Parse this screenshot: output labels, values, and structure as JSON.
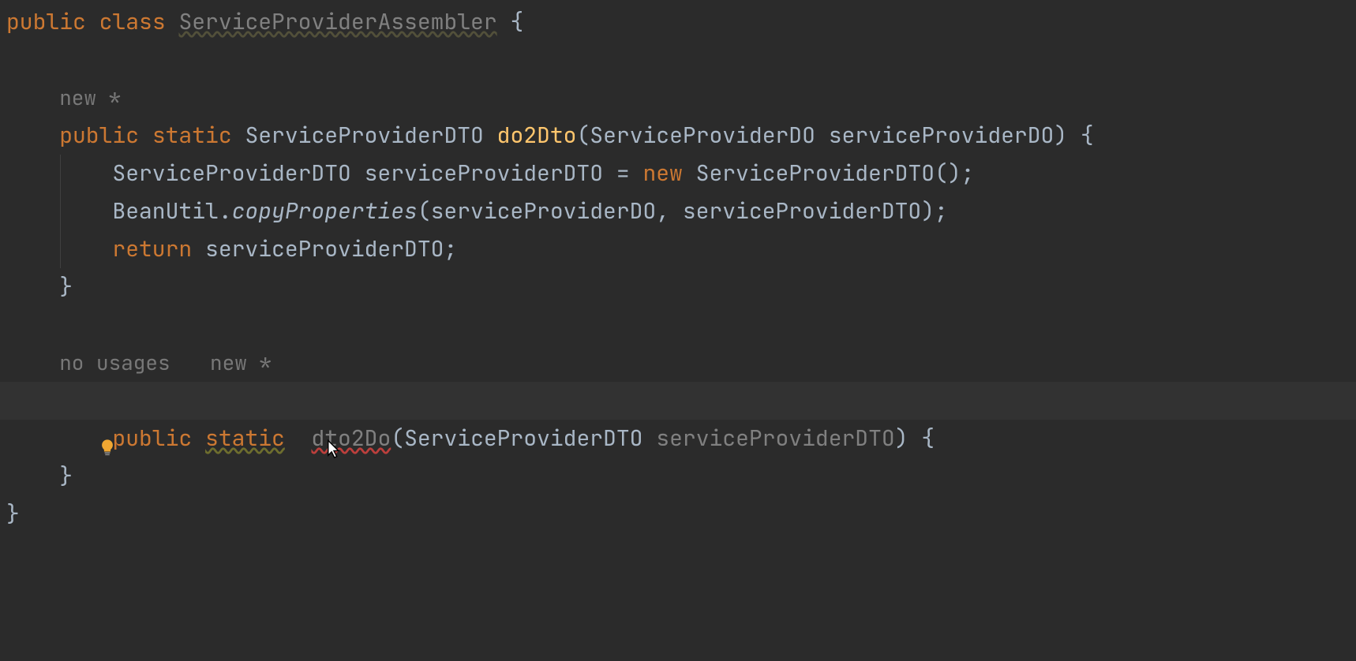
{
  "code": {
    "line1": {
      "kw_public": "public",
      "kw_class": "class",
      "classname": "ServiceProviderAssembler",
      "brace": " {"
    },
    "hint1": "new *",
    "line_method1_sig": {
      "kw_public": "public",
      "kw_static": "static",
      "ret_type": "ServiceProviderDTO",
      "method": "do2Dto",
      "paren_open": "(",
      "param_type": "ServiceProviderDO",
      "param_name": "serviceProviderDO",
      "paren_close_brace": ") {"
    },
    "line_body1": {
      "type": "ServiceProviderDTO",
      "var": "serviceProviderDTO",
      "eq": " = ",
      "kw_new": "new",
      "ctor": "ServiceProviderDTO",
      "tail": "();"
    },
    "line_body2": {
      "cls": "BeanUtil",
      "dot": ".",
      "method": "copyProperties",
      "args": "(serviceProviderDO, serviceProviderDTO);"
    },
    "line_body3": {
      "kw_return": "return",
      "var": "serviceProviderDTO",
      "semi": ";"
    },
    "close1": "}",
    "hint2a": "no usages",
    "hint2b": "new *",
    "line_method2_sig": {
      "kw_public": "public",
      "kw_static": "static",
      "method": "dto2Do",
      "paren_open": "(",
      "param_type": "ServiceProviderDTO",
      "param_name": "serviceProviderDTO",
      "paren_close_brace": ") {"
    },
    "close2": "}",
    "close_class": "}"
  }
}
